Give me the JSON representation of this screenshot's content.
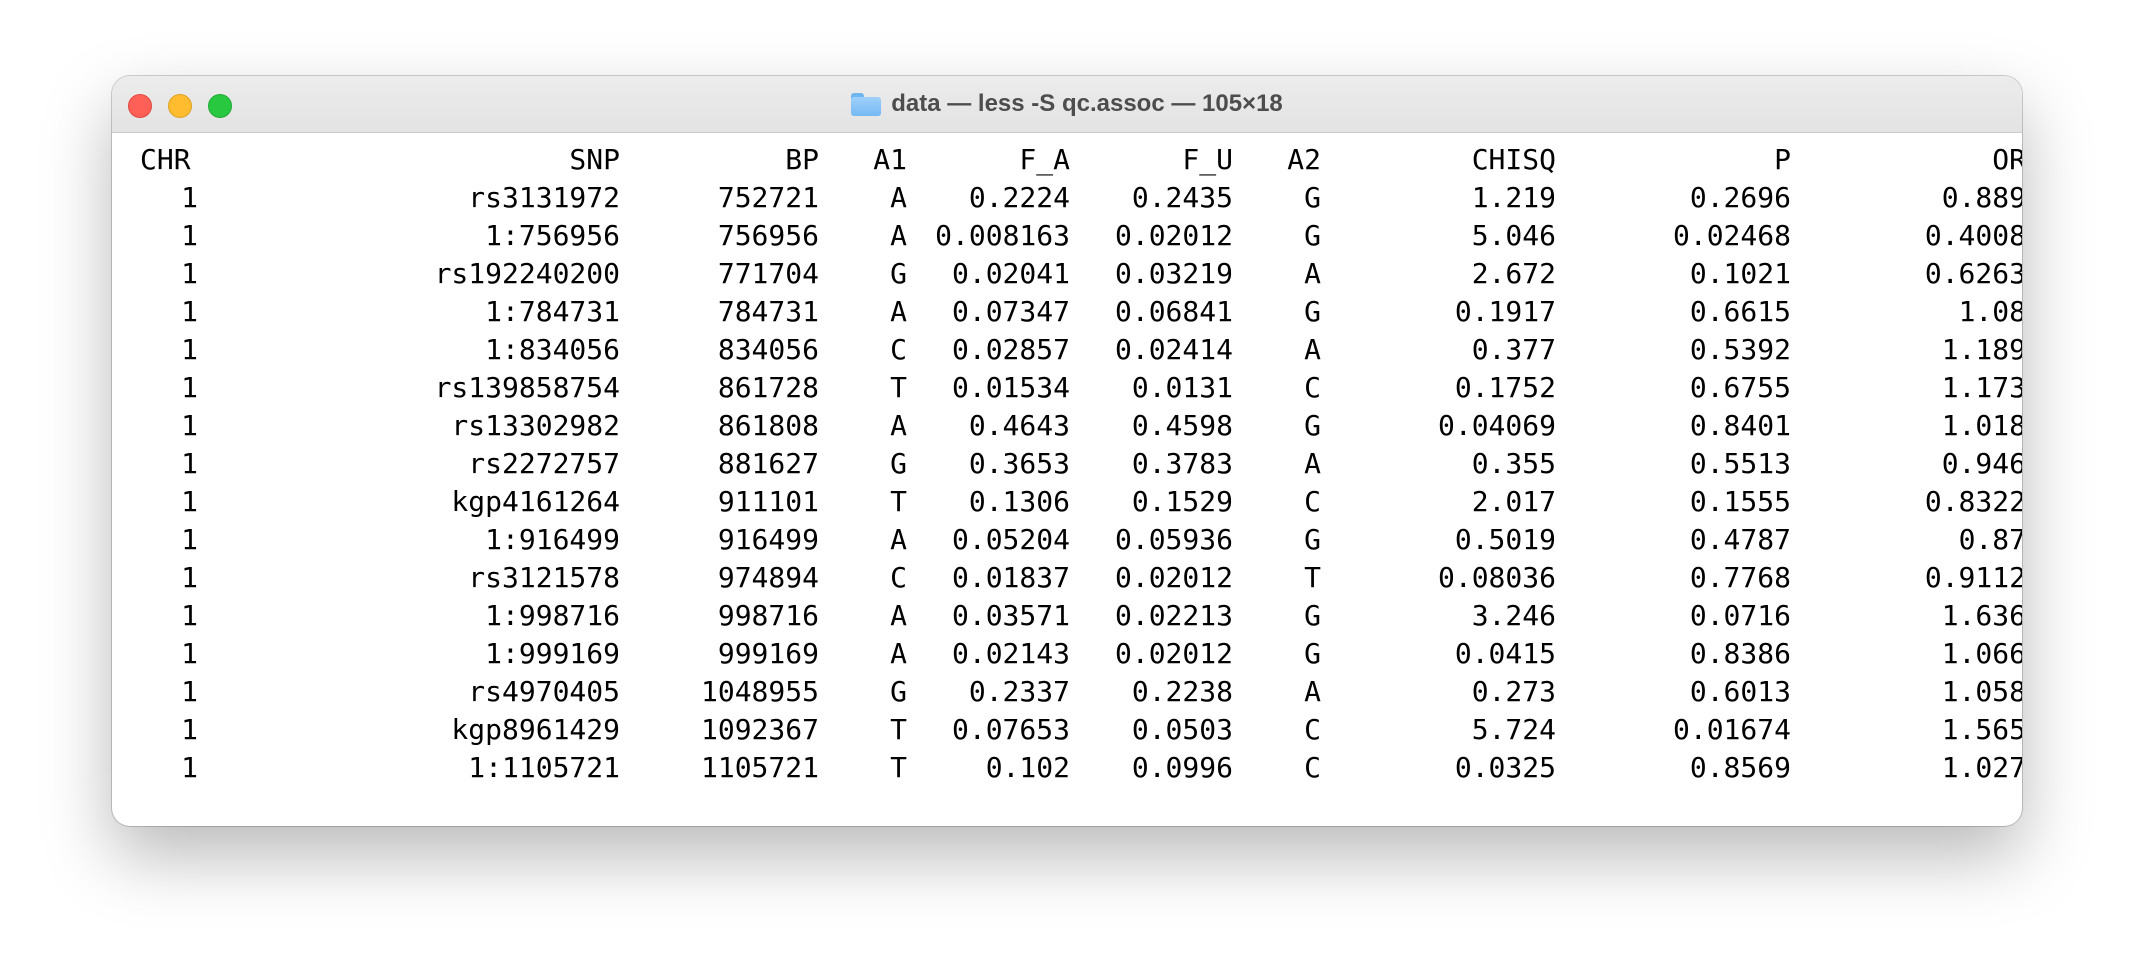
{
  "window": {
    "title": "data — less -S qc.assoc — 105×18",
    "folder_icon": "folder-icon"
  },
  "table": {
    "headers": [
      "CHR",
      "SNP",
      "BP",
      "A1",
      "F_A",
      "F_U",
      "A2",
      "CHISQ",
      "P",
      "OR"
    ],
    "rows": [
      [
        "1",
        "rs3131972",
        "752721",
        "A",
        "0.2224",
        "0.2435",
        "G",
        "1.219",
        "0.2696",
        "0.889"
      ],
      [
        "1",
        "1:756956",
        "756956",
        "A",
        "0.008163",
        "0.02012",
        "G",
        "5.046",
        "0.02468",
        "0.4008"
      ],
      [
        "1",
        "rs192240200",
        "771704",
        "G",
        "0.02041",
        "0.03219",
        "A",
        "2.672",
        "0.1021",
        "0.6263"
      ],
      [
        "1",
        "1:784731",
        "784731",
        "A",
        "0.07347",
        "0.06841",
        "G",
        "0.1917",
        "0.6615",
        "1.08"
      ],
      [
        "1",
        "1:834056",
        "834056",
        "C",
        "0.02857",
        "0.02414",
        "A",
        "0.377",
        "0.5392",
        "1.189"
      ],
      [
        "1",
        "rs139858754",
        "861728",
        "T",
        "0.01534",
        "0.0131",
        "C",
        "0.1752",
        "0.6755",
        "1.173"
      ],
      [
        "1",
        "rs13302982",
        "861808",
        "A",
        "0.4643",
        "0.4598",
        "G",
        "0.04069",
        "0.8401",
        "1.018"
      ],
      [
        "1",
        "rs2272757",
        "881627",
        "G",
        "0.3653",
        "0.3783",
        "A",
        "0.355",
        "0.5513",
        "0.946"
      ],
      [
        "1",
        "kgp4161264",
        "911101",
        "T",
        "0.1306",
        "0.1529",
        "C",
        "2.017",
        "0.1555",
        "0.8322"
      ],
      [
        "1",
        "1:916499",
        "916499",
        "A",
        "0.05204",
        "0.05936",
        "G",
        "0.5019",
        "0.4787",
        "0.87"
      ],
      [
        "1",
        "rs3121578",
        "974894",
        "C",
        "0.01837",
        "0.02012",
        "T",
        "0.08036",
        "0.7768",
        "0.9112"
      ],
      [
        "1",
        "1:998716",
        "998716",
        "A",
        "0.03571",
        "0.02213",
        "G",
        "3.246",
        "0.0716",
        "1.636"
      ],
      [
        "1",
        "1:999169",
        "999169",
        "A",
        "0.02143",
        "0.02012",
        "G",
        "0.0415",
        "0.8386",
        "1.066"
      ],
      [
        "1",
        "rs4970405",
        "1048955",
        "G",
        "0.2337",
        "0.2238",
        "A",
        "0.273",
        "0.6013",
        "1.058"
      ],
      [
        "1",
        "kgp8961429",
        "1092367",
        "T",
        "0.07653",
        "0.0503",
        "C",
        "5.724",
        "0.01674",
        "1.565"
      ],
      [
        "1",
        "1:1105721",
        "1105721",
        "T",
        "0.102",
        "0.0996",
        "C",
        "0.0325",
        "0.8569",
        "1.027"
      ]
    ]
  },
  "prompt": {
    "text": ":"
  }
}
